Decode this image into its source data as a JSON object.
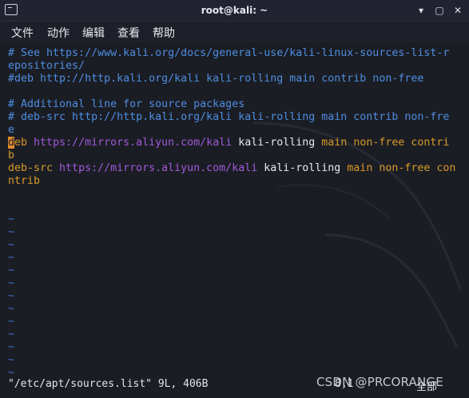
{
  "window": {
    "title": "root@kali: ~",
    "min_label": "▾",
    "max_label": "▢",
    "close_label": "✕"
  },
  "menu": [
    "文件",
    "动作",
    "编辑",
    "查看",
    "帮助"
  ],
  "editor": {
    "lines": [
      [
        {
          "t": "# See https://www.kali.org/docs/general-use/kali-linux-sources-list-r",
          "c": "blue"
        }
      ],
      [
        {
          "t": "epositories/",
          "c": "blue"
        }
      ],
      [
        {
          "t": "#deb http://http.kali.org/kali kali-rolling main contrib non-free",
          "c": "blue"
        }
      ],
      [
        {
          "t": "",
          "c": "blue"
        }
      ],
      [
        {
          "t": "# Additional line for source packages",
          "c": "blue"
        }
      ],
      [
        {
          "t": "# deb-src http://http.kali.org/kali kali-rolling main contrib non-fre",
          "c": "blue"
        }
      ],
      [
        {
          "t": "e",
          "c": "blue"
        }
      ],
      [
        {
          "t": "d",
          "c": "cursor"
        },
        {
          "t": "eb ",
          "c": "orange"
        },
        {
          "t": "https://mirrors.aliyun.com/kali",
          "c": "purple"
        },
        {
          "t": " kali-rolling ",
          "c": "white"
        },
        {
          "t": "main non-free contri",
          "c": "orange"
        }
      ],
      [
        {
          "t": "b",
          "c": "orange"
        }
      ],
      [
        {
          "t": "deb-src ",
          "c": "orange"
        },
        {
          "t": "https://mirrors.aliyun.com/kali",
          "c": "purple"
        },
        {
          "t": " kali-rolling ",
          "c": "white"
        },
        {
          "t": "main non-free co",
          "c": "orange"
        },
        {
          "t": "n",
          "c": "orange"
        }
      ],
      [
        {
          "t": "ntrib",
          "c": "orange"
        }
      ]
    ],
    "tilde": "~",
    "tilde_count": 13,
    "status_file": "\"/etc/apt/sources.list\" 9L, 406B",
    "cursor_pos": "8,1",
    "scroll_pct": "全部"
  },
  "watermark": "CSDN @PRCORANGE",
  "colors": {
    "blue": "#4d8de0",
    "purple": "#9f59d9",
    "orange": "#d79a28",
    "white": "#e8eaee",
    "cursor": "#e08c2c"
  }
}
